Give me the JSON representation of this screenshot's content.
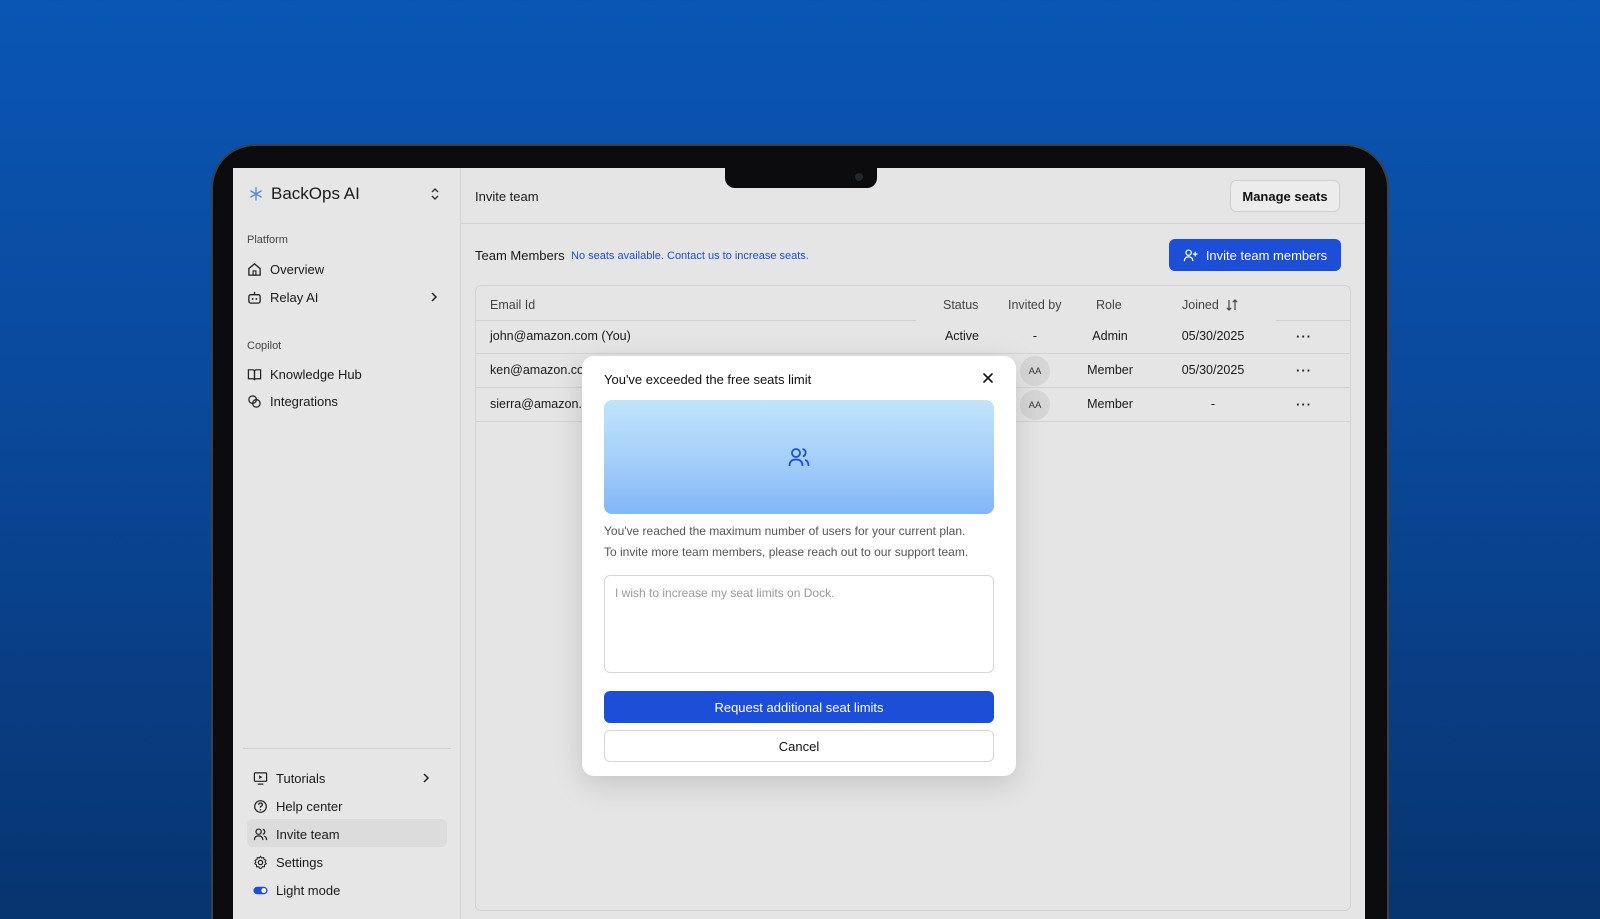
{
  "brand": {
    "name": "BackOps AI",
    "logo_icon": "asterisk-icon",
    "toggle_icon": "chevron-up-down-icon"
  },
  "sidebar": {
    "platform_label": "Platform",
    "platform_items": [
      {
        "label": "Overview",
        "icon": "home-icon"
      },
      {
        "label": "Relay AI",
        "icon": "bot-icon"
      }
    ],
    "copilot_label": "Copilot",
    "copilot_items": [
      {
        "label": "Knowledge Hub",
        "icon": "book-icon"
      },
      {
        "label": "Integrations",
        "icon": "link-icon"
      }
    ],
    "bottom_items": [
      {
        "label": "Tutorials",
        "icon": "presentation-icon"
      },
      {
        "label": "Help center",
        "icon": "help-circle-icon"
      },
      {
        "label": "Invite team",
        "icon": "users-icon"
      },
      {
        "label": "Settings",
        "icon": "gear-icon"
      },
      {
        "label": "Light mode",
        "icon": "toggle-icon"
      }
    ]
  },
  "header": {
    "title": "Invite team",
    "manage_seats": "Manage seats"
  },
  "team": {
    "label": "Team Members",
    "notice": "No seats available. Contact us to increase seats.",
    "invite_button": "Invite team members"
  },
  "table": {
    "columns": {
      "email": "Email Id",
      "status": "Status",
      "invited_by": "Invited by",
      "role": "Role",
      "joined": "Joined"
    },
    "rows": [
      {
        "email": "john@amazon.com (You)",
        "status": "Active",
        "invited_by": "-",
        "role": "Admin",
        "joined": "05/30/2025",
        "more": "···"
      },
      {
        "email": "ken@amazon.com",
        "status": "",
        "invited_by": "AA",
        "role": "Member",
        "joined": "05/30/2025",
        "more": "···"
      },
      {
        "email": "sierra@amazon.com",
        "status": "",
        "invited_by": "AA",
        "role": "Member",
        "joined": "-",
        "more": "···"
      }
    ]
  },
  "modal": {
    "title": "You've exceeded the free seats limit",
    "banner_icon": "users-icon",
    "line1": "You've reached the maximum number of users for your current plan.",
    "line2": "To invite more team members, please reach out to our support team.",
    "placeholder": "I wish to increase my seat limits on Dock.",
    "request_button": "Request additional seat limits",
    "cancel_button": "Cancel"
  },
  "colors": {
    "accent": "#1d4ed8",
    "background": "#0a56b4"
  }
}
